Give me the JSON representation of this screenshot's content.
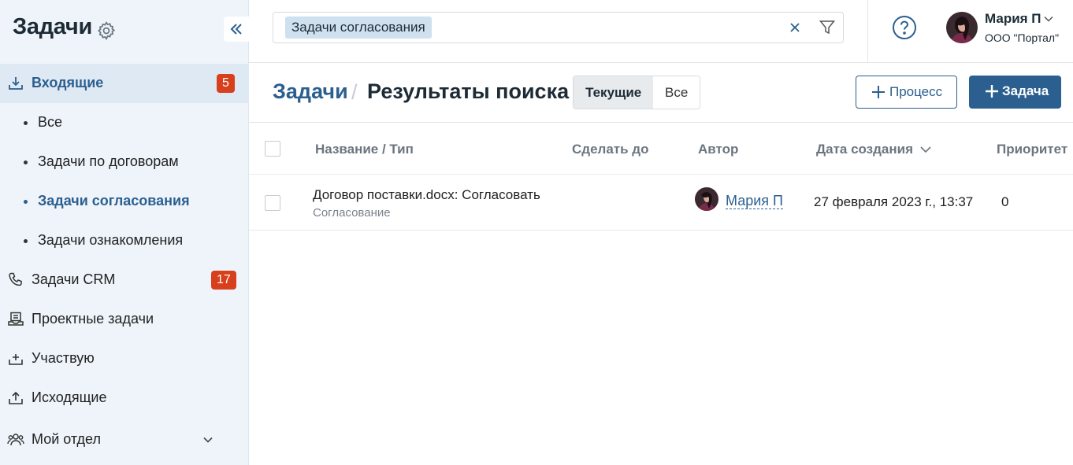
{
  "sidebar": {
    "title": "Задачи",
    "items": [
      {
        "label": "Входящие",
        "badge": "5"
      },
      {
        "label": "Все"
      },
      {
        "label": "Задачи по договорам"
      },
      {
        "label": "Задачи согласования"
      },
      {
        "label": "Задачи ознакомления"
      },
      {
        "label": "Задачи CRM",
        "badge": "17"
      },
      {
        "label": "Проектные задачи"
      },
      {
        "label": "Участвую"
      },
      {
        "label": "Исходящие"
      },
      {
        "label": "Мой отдел"
      }
    ]
  },
  "search": {
    "chip": "Задачи согласования"
  },
  "user": {
    "name": "Мария П",
    "org": "ООО \"Портал\""
  },
  "header": {
    "crumb_root": "Задачи",
    "crumb_sep": "/",
    "crumb_current": "Результаты поиска",
    "seg_current": "Текущие",
    "seg_all": "Все",
    "btn_process": "Процесс",
    "btn_task": "Задача"
  },
  "table": {
    "columns": [
      "Название / Тип",
      "Сделать до",
      "Автор",
      "Дата создания",
      "Приоритет"
    ],
    "rows": [
      {
        "name": "Договор поставки.docx: Согласовать",
        "type": "Согласование",
        "due": "",
        "author": "Мария П",
        "created": "27 февраля 2023 г., 13:37",
        "priority": "0"
      }
    ]
  },
  "colors": {
    "accent": "#2b5f8f",
    "badge": "#d8401d",
    "sidebar_bg": "#eef4fa"
  }
}
